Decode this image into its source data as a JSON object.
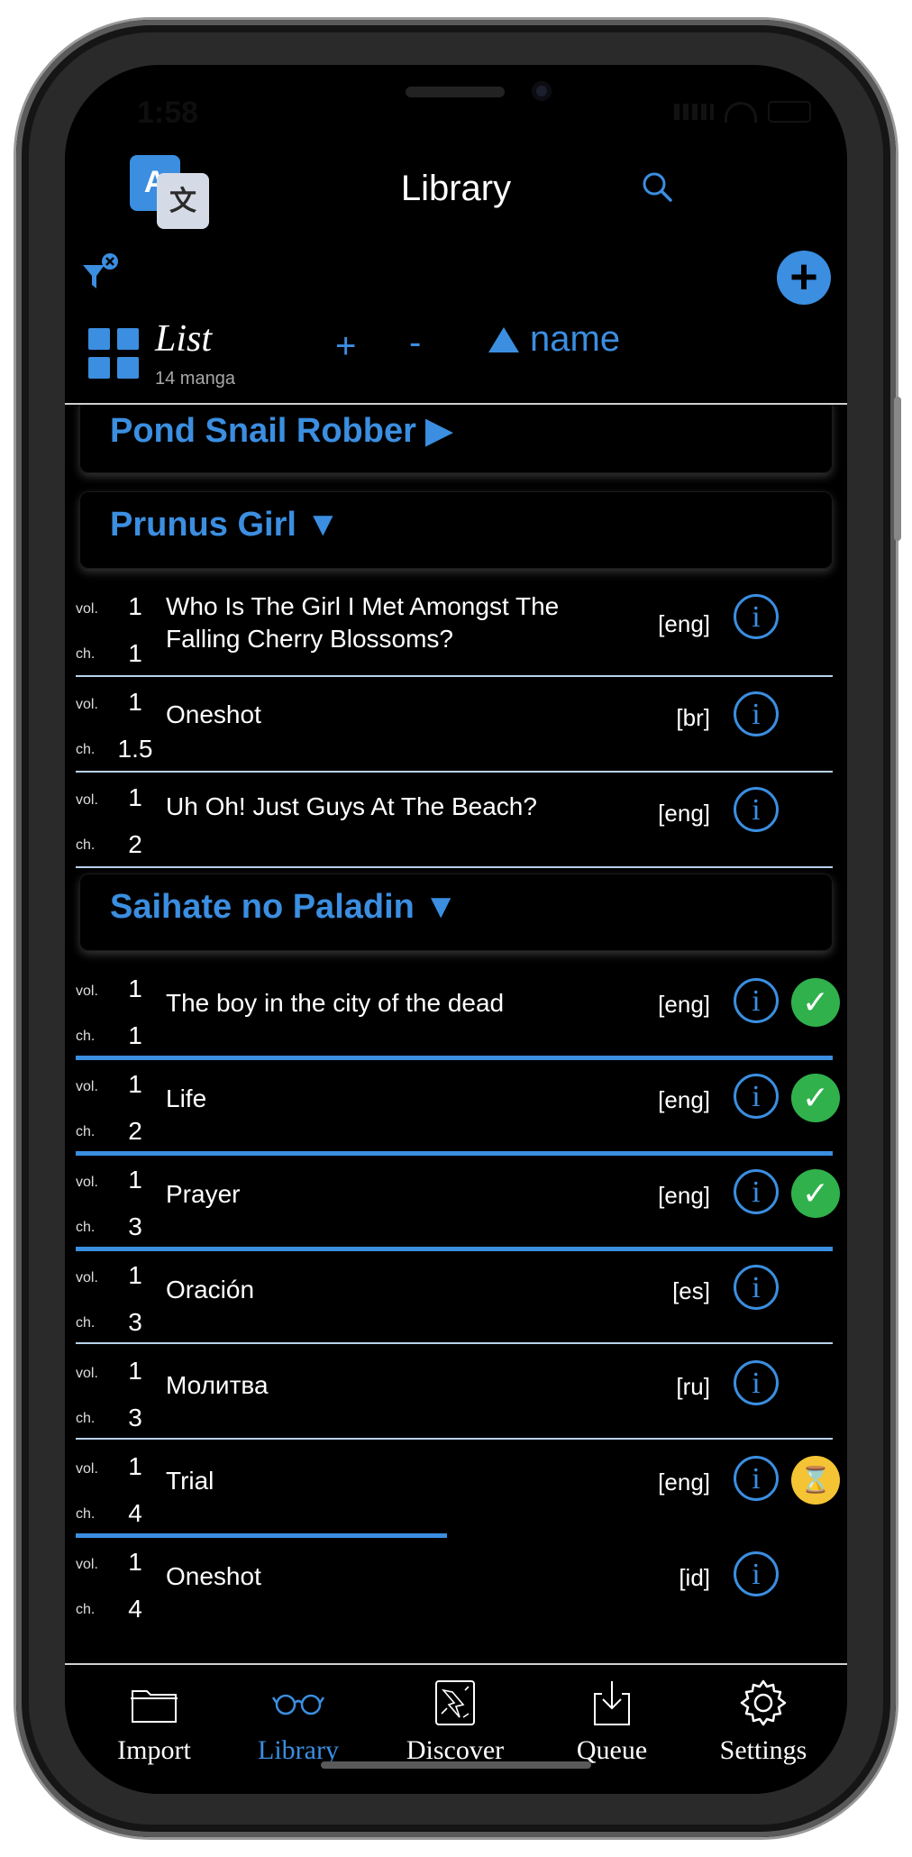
{
  "status_bar": {
    "time": "1:58"
  },
  "header": {
    "title": "Library"
  },
  "toolbar": {
    "view_title": "List",
    "count": "14 manga",
    "zoom_in": "+",
    "zoom_out": "-",
    "sort": "name"
  },
  "groups": [
    {
      "title": "Pond Snail Robber ▶"
    },
    {
      "title": "Prunus Girl ▼"
    },
    {
      "title": "Saihate no Paladin ▼"
    }
  ],
  "labels": {
    "vol": "vol.",
    "ch": "ch."
  },
  "chapters": [
    {
      "vol": "1",
      "ch": "1",
      "title": "Who Is The Girl I Met Amongst The Falling Cherry Blossoms?",
      "lang": "[eng]",
      "status": "none"
    },
    {
      "vol": "1",
      "ch": "1.5",
      "title": "Oneshot",
      "lang": "[br]",
      "status": "none"
    },
    {
      "vol": "1",
      "ch": "2",
      "title": "Uh Oh! Just Guys At The Beach?",
      "lang": "[eng]",
      "status": "none"
    },
    {
      "vol": "1",
      "ch": "1",
      "title": "The boy in the city of the dead",
      "lang": "[eng]",
      "status": "read",
      "progress": 1.0
    },
    {
      "vol": "1",
      "ch": "2",
      "title": "Life",
      "lang": "[eng]",
      "status": "read",
      "progress": 1.0
    },
    {
      "vol": "1",
      "ch": "3",
      "title": "Prayer",
      "lang": "[eng]",
      "status": "read",
      "progress": 1.0
    },
    {
      "vol": "1",
      "ch": "3",
      "title": "Oración",
      "lang": "[es]",
      "status": "none"
    },
    {
      "vol": "1",
      "ch": "3",
      "title": "Молитва",
      "lang": "[ru]",
      "status": "none"
    },
    {
      "vol": "1",
      "ch": "4",
      "title": "Trial",
      "lang": "[eng]",
      "status": "pending",
      "progress": 0.49
    },
    {
      "vol": "1",
      "ch": "4",
      "title": "Oneshot",
      "lang": "[id]",
      "status": "none"
    }
  ],
  "tabs": [
    {
      "label": "Import",
      "icon": "folder-icon"
    },
    {
      "label": "Library",
      "icon": "glasses-icon",
      "active": true
    },
    {
      "label": "Discover",
      "icon": "discover-icon"
    },
    {
      "label": "Queue",
      "icon": "download-tray-icon"
    },
    {
      "label": "Settings",
      "icon": "gear-icon"
    }
  ],
  "colors": {
    "accent": "#3b8ee0",
    "done": "#30b14c",
    "pending": "#f5c434",
    "background": "#000000"
  }
}
